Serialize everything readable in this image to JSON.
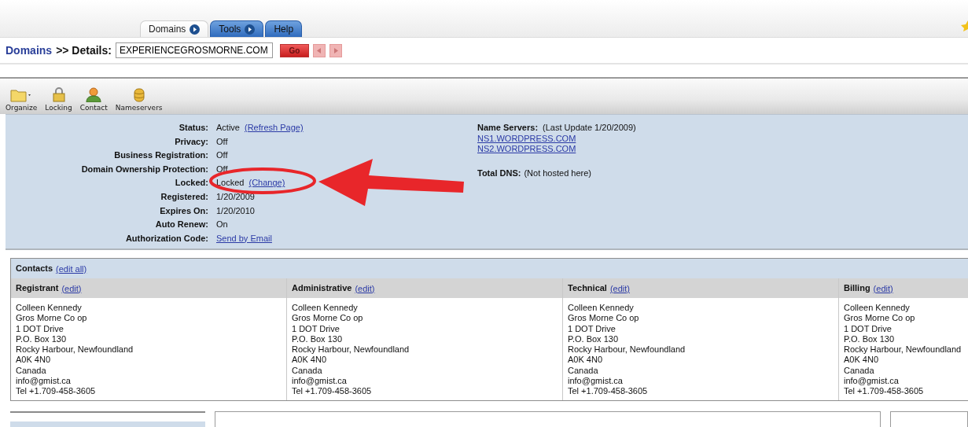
{
  "tabs": [
    {
      "label": "Domains",
      "selected": true,
      "has_menu": true
    },
    {
      "label": "Tools",
      "selected": false,
      "has_menu": true
    },
    {
      "label": "Help",
      "selected": false,
      "has_menu": false
    }
  ],
  "breadcrumb": {
    "link": "Domains",
    "text": ">> Details:"
  },
  "domain_field": {
    "value": "EXPERIENCEGROSMORNE.COM"
  },
  "go_button": "Go",
  "toolbar": [
    {
      "label": "Organize"
    },
    {
      "label": "Locking"
    },
    {
      "label": "Contact"
    },
    {
      "label": "Nameservers"
    }
  ],
  "details": [
    {
      "label": "Status:",
      "value": "Active",
      "link": "(Refresh Page)"
    },
    {
      "label": "Privacy:",
      "value": "Off"
    },
    {
      "label": "Business Registration:",
      "value": "Off"
    },
    {
      "label": "Domain Ownership Protection:",
      "value": "Off"
    },
    {
      "label": "Locked:",
      "value": "Locked",
      "link": "(Change)"
    },
    {
      "label": "Registered:",
      "value": "1/20/2009"
    },
    {
      "label": "Expires On:",
      "value": "1/20/2010"
    },
    {
      "label": "Auto Renew:",
      "value": "On"
    },
    {
      "label": "Authorization Code:",
      "link": "Send by Email"
    }
  ],
  "name_servers": {
    "label": "Name Servers:",
    "note": "(Last Update 1/20/2009)",
    "links": [
      "NS1.WORDPRESS.COM",
      "NS2.WORDPRESS.COM"
    ]
  },
  "total_dns": {
    "label": "Total DNS:",
    "value": "(Not hosted here)"
  },
  "contacts": {
    "title": "Contacts",
    "edit_all": "(edit all)",
    "columns": [
      {
        "title": "Registrant",
        "edit": "(edit)",
        "lines": [
          "Colleen Kennedy",
          "Gros Morne Co op",
          "1 DOT Drive",
          "P.O. Box 130",
          "Rocky Harbour, Newfoundland",
          "A0K 4N0",
          "Canada",
          "info@gmist.ca",
          "Tel +1.709-458-3605"
        ]
      },
      {
        "title": "Administrative",
        "edit": "(edit)",
        "lines": [
          "Colleen Kennedy",
          "Gros Morne Co op",
          "1 DOT Drive",
          "P.O. Box 130",
          "Rocky Harbour, Newfoundland",
          "A0K 4N0",
          "Canada",
          "info@gmist.ca",
          "Tel +1.709-458-3605"
        ]
      },
      {
        "title": "Technical",
        "edit": "(edit)",
        "lines": [
          "Colleen Kennedy",
          "Gros Morne Co op",
          "1 DOT Drive",
          "P.O. Box 130",
          "Rocky Harbour, Newfoundland",
          "A0K 4N0",
          "Canada",
          "info@gmist.ca",
          "Tel +1.709-458-3605"
        ]
      },
      {
        "title": "Billing",
        "edit": "(edit)",
        "lines": [
          "Colleen Kennedy",
          "Gros Morne Co op",
          "1 DOT Drive",
          "P.O. Box 130",
          "Rocky Harbour, Newfoundland",
          "A0K 4N0",
          "Canada",
          "info@gmist.ca",
          "Tel +1.709-458-3605"
        ]
      }
    ]
  }
}
